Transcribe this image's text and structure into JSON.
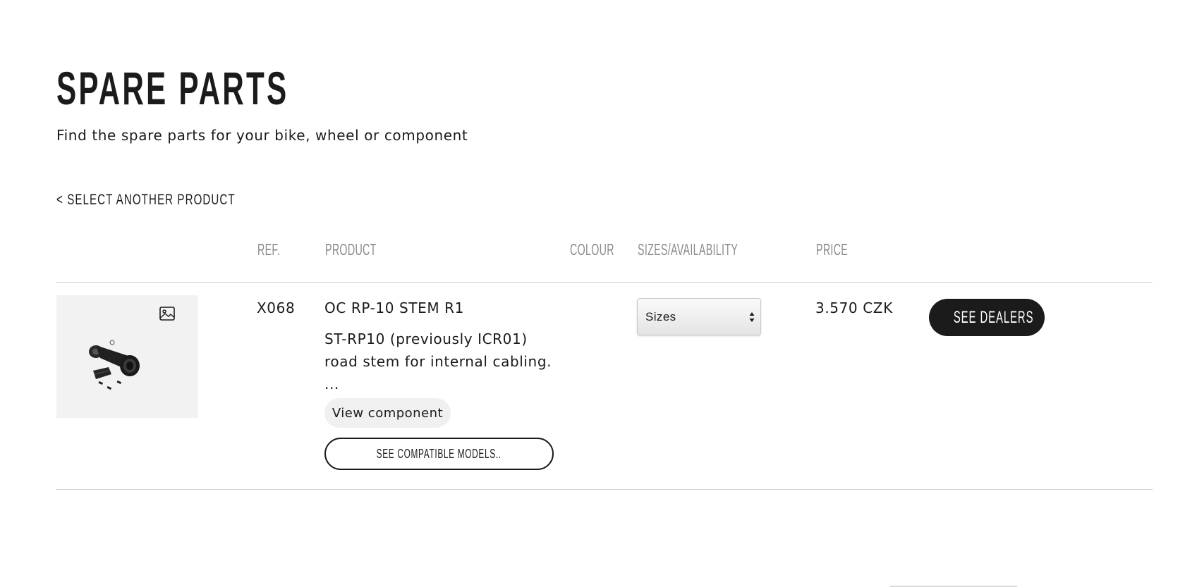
{
  "header": {
    "title": "SPARE PARTS",
    "subtitle": "Find the spare parts for your bike, wheel or component"
  },
  "nav": {
    "back_label": "< SELECT ANOTHER PRODUCT"
  },
  "table": {
    "columns": {
      "ref": "REF.",
      "product": "PRODUCT",
      "colour": "COLOUR",
      "sizes": "SIZES/AVAILABILITY",
      "price": "PRICE"
    },
    "rows": [
      {
        "image_icon": "image-icon",
        "ref": "X068",
        "product_name": "OC RP-10 STEM R1",
        "description": "ST-RP10 (previously ICR01) road stem for internal cabling.",
        "ellipsis": "...",
        "view_component_label": "View component",
        "compatible_models_label": "SEE COMPATIBLE MODELS..",
        "colour": "",
        "sizes_selected": "Sizes",
        "price": "3.570 CZK",
        "dealers_label": "SEE DEALERS"
      }
    ]
  },
  "colors": {
    "text": "#1b1b1b",
    "muted_header": "#8a8a8a",
    "divider": "#cfcfcf",
    "button_dark": "#1b1b1b",
    "thumb_bg": "#f2f2f2"
  }
}
